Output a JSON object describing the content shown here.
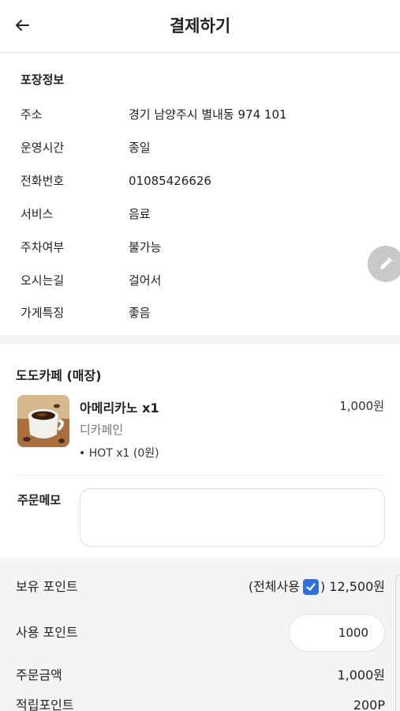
{
  "header": {
    "title": "결제하기"
  },
  "packaging": {
    "section_title": "포장정보",
    "rows": [
      {
        "key": "주소",
        "value": "경기 남양주시 별내동 974 101"
      },
      {
        "key": "운영시간",
        "value": "종일"
      },
      {
        "key": "전화번호",
        "value": "01085426626"
      },
      {
        "key": "서비스",
        "value": "음료"
      },
      {
        "key": "주차여부",
        "value": "불가능"
      },
      {
        "key": "오시는길",
        "value": "걸어서"
      },
      {
        "key": "가게특징",
        "value": "좋음"
      }
    ]
  },
  "order": {
    "store_name": "도도카페 (매장)",
    "item": {
      "name": "아메리카노 x1",
      "price": "1,000원",
      "option": "디카페인",
      "sub_option": "• HOT x1 (0원)"
    },
    "memo": {
      "label": "주문메모",
      "value": ""
    }
  },
  "points": {
    "owned_label": "보유 포인트",
    "use_all_prefix": "(전체사용",
    "use_all_checked": true,
    "owned_suffix": ") 12,500원",
    "use_label": "사용 포인트",
    "use_value": "1000",
    "order_amount_label": "주문금액",
    "order_amount_value": "1,000원",
    "earn_label": "적립포인트",
    "earn_value": "200P"
  },
  "colors": {
    "checkbox": "#2f6fe0",
    "fab": "#c9c9c9"
  },
  "icons": {
    "back": "arrow-left-icon",
    "edit": "pencil-icon",
    "check": "checkmark-icon"
  }
}
